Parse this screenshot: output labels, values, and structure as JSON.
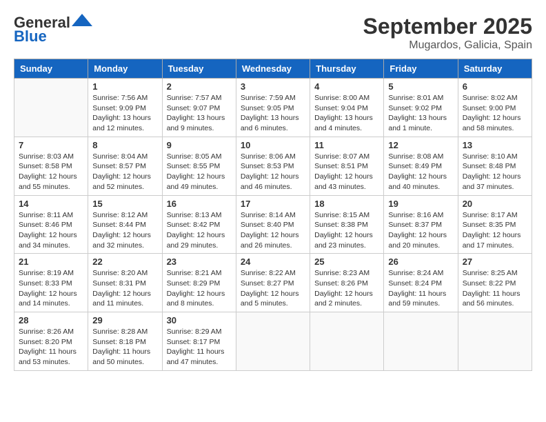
{
  "logo": {
    "general": "General",
    "blue": "Blue"
  },
  "title": "September 2025",
  "subtitle": "Mugardos, Galicia, Spain",
  "days_of_week": [
    "Sunday",
    "Monday",
    "Tuesday",
    "Wednesday",
    "Thursday",
    "Friday",
    "Saturday"
  ],
  "weeks": [
    [
      {
        "day": "",
        "info": ""
      },
      {
        "day": "1",
        "info": "Sunrise: 7:56 AM\nSunset: 9:09 PM\nDaylight: 13 hours\nand 12 minutes."
      },
      {
        "day": "2",
        "info": "Sunrise: 7:57 AM\nSunset: 9:07 PM\nDaylight: 13 hours\nand 9 minutes."
      },
      {
        "day": "3",
        "info": "Sunrise: 7:59 AM\nSunset: 9:05 PM\nDaylight: 13 hours\nand 6 minutes."
      },
      {
        "day": "4",
        "info": "Sunrise: 8:00 AM\nSunset: 9:04 PM\nDaylight: 13 hours\nand 4 minutes."
      },
      {
        "day": "5",
        "info": "Sunrise: 8:01 AM\nSunset: 9:02 PM\nDaylight: 13 hours\nand 1 minute."
      },
      {
        "day": "6",
        "info": "Sunrise: 8:02 AM\nSunset: 9:00 PM\nDaylight: 12 hours\nand 58 minutes."
      }
    ],
    [
      {
        "day": "7",
        "info": "Sunrise: 8:03 AM\nSunset: 8:58 PM\nDaylight: 12 hours\nand 55 minutes."
      },
      {
        "day": "8",
        "info": "Sunrise: 8:04 AM\nSunset: 8:57 PM\nDaylight: 12 hours\nand 52 minutes."
      },
      {
        "day": "9",
        "info": "Sunrise: 8:05 AM\nSunset: 8:55 PM\nDaylight: 12 hours\nand 49 minutes."
      },
      {
        "day": "10",
        "info": "Sunrise: 8:06 AM\nSunset: 8:53 PM\nDaylight: 12 hours\nand 46 minutes."
      },
      {
        "day": "11",
        "info": "Sunrise: 8:07 AM\nSunset: 8:51 PM\nDaylight: 12 hours\nand 43 minutes."
      },
      {
        "day": "12",
        "info": "Sunrise: 8:08 AM\nSunset: 8:49 PM\nDaylight: 12 hours\nand 40 minutes."
      },
      {
        "day": "13",
        "info": "Sunrise: 8:10 AM\nSunset: 8:48 PM\nDaylight: 12 hours\nand 37 minutes."
      }
    ],
    [
      {
        "day": "14",
        "info": "Sunrise: 8:11 AM\nSunset: 8:46 PM\nDaylight: 12 hours\nand 34 minutes."
      },
      {
        "day": "15",
        "info": "Sunrise: 8:12 AM\nSunset: 8:44 PM\nDaylight: 12 hours\nand 32 minutes."
      },
      {
        "day": "16",
        "info": "Sunrise: 8:13 AM\nSunset: 8:42 PM\nDaylight: 12 hours\nand 29 minutes."
      },
      {
        "day": "17",
        "info": "Sunrise: 8:14 AM\nSunset: 8:40 PM\nDaylight: 12 hours\nand 26 minutes."
      },
      {
        "day": "18",
        "info": "Sunrise: 8:15 AM\nSunset: 8:38 PM\nDaylight: 12 hours\nand 23 minutes."
      },
      {
        "day": "19",
        "info": "Sunrise: 8:16 AM\nSunset: 8:37 PM\nDaylight: 12 hours\nand 20 minutes."
      },
      {
        "day": "20",
        "info": "Sunrise: 8:17 AM\nSunset: 8:35 PM\nDaylight: 12 hours\nand 17 minutes."
      }
    ],
    [
      {
        "day": "21",
        "info": "Sunrise: 8:19 AM\nSunset: 8:33 PM\nDaylight: 12 hours\nand 14 minutes."
      },
      {
        "day": "22",
        "info": "Sunrise: 8:20 AM\nSunset: 8:31 PM\nDaylight: 12 hours\nand 11 minutes."
      },
      {
        "day": "23",
        "info": "Sunrise: 8:21 AM\nSunset: 8:29 PM\nDaylight: 12 hours\nand 8 minutes."
      },
      {
        "day": "24",
        "info": "Sunrise: 8:22 AM\nSunset: 8:27 PM\nDaylight: 12 hours\nand 5 minutes."
      },
      {
        "day": "25",
        "info": "Sunrise: 8:23 AM\nSunset: 8:26 PM\nDaylight: 12 hours\nand 2 minutes."
      },
      {
        "day": "26",
        "info": "Sunrise: 8:24 AM\nSunset: 8:24 PM\nDaylight: 11 hours\nand 59 minutes."
      },
      {
        "day": "27",
        "info": "Sunrise: 8:25 AM\nSunset: 8:22 PM\nDaylight: 11 hours\nand 56 minutes."
      }
    ],
    [
      {
        "day": "28",
        "info": "Sunrise: 8:26 AM\nSunset: 8:20 PM\nDaylight: 11 hours\nand 53 minutes."
      },
      {
        "day": "29",
        "info": "Sunrise: 8:28 AM\nSunset: 8:18 PM\nDaylight: 11 hours\nand 50 minutes."
      },
      {
        "day": "30",
        "info": "Sunrise: 8:29 AM\nSunset: 8:17 PM\nDaylight: 11 hours\nand 47 minutes."
      },
      {
        "day": "",
        "info": ""
      },
      {
        "day": "",
        "info": ""
      },
      {
        "day": "",
        "info": ""
      },
      {
        "day": "",
        "info": ""
      }
    ]
  ]
}
